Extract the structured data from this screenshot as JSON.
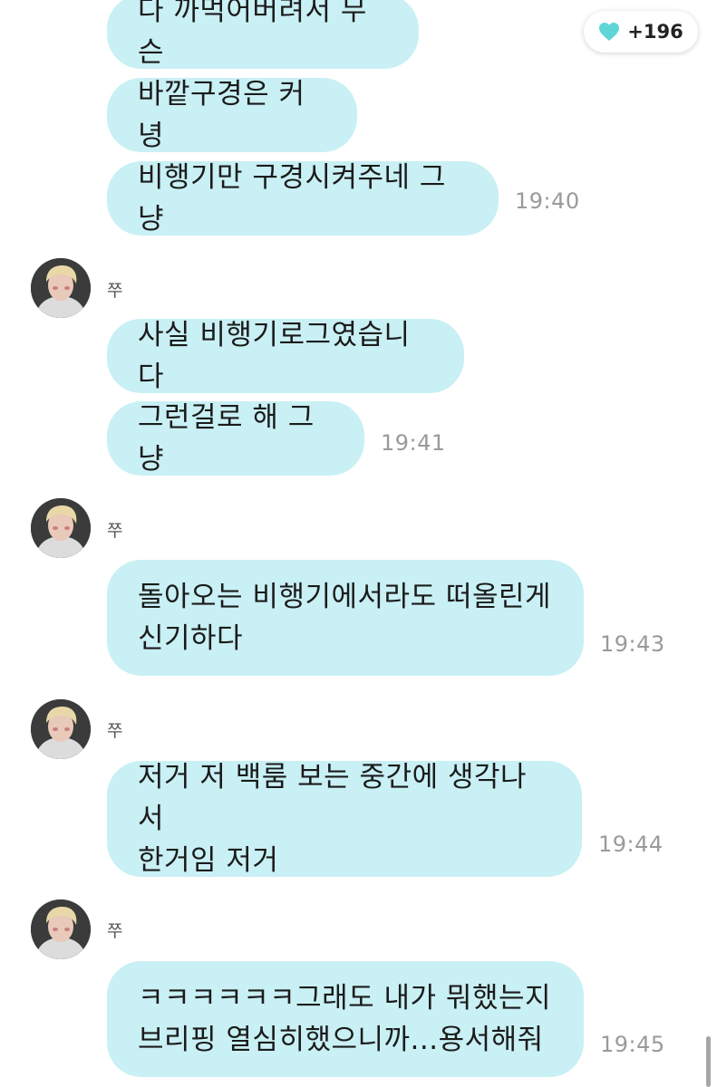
{
  "likes": {
    "count": "+196",
    "icon": "heart-icon",
    "color": "#5fd5d8"
  },
  "theme": {
    "bubble_color": "#c9f0f4",
    "time_color": "#9a9a9a"
  },
  "messages": [
    {
      "text": "다 까먹어버려서 무슨",
      "time": ""
    },
    {
      "text": "바깥구경은 커녕",
      "time": ""
    },
    {
      "text": "비행기만 구경시켜주네 그냥",
      "time": "19:40"
    },
    {
      "sender": "쭈",
      "text": "사실 비행기로그였습니다",
      "time": ""
    },
    {
      "text": "그런걸로 해 그냥",
      "time": "19:41"
    },
    {
      "sender": "쭈",
      "text": "돌아오는 비행기에서라도 떠올린게\n신기하다",
      "time": "19:43"
    },
    {
      "sender": "쭈",
      "text": "저거 저 백룸 보는 중간에 생각나서\n한거임 저거",
      "time": "19:44"
    },
    {
      "sender": "쭈",
      "text": "ㅋㅋㅋㅋㅋㅋ그래도 내가 뭐했는지\n브리핑 열심히했으니까...용서해줘",
      "time": "19:45"
    }
  ]
}
